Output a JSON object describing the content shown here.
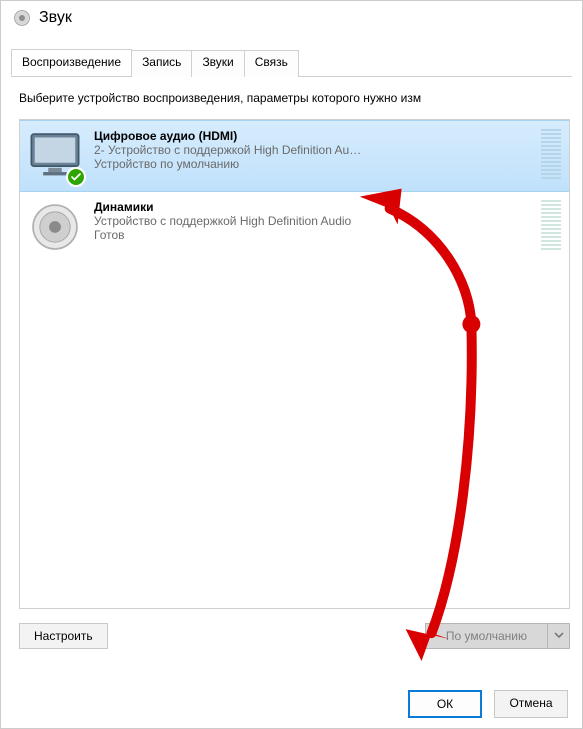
{
  "window": {
    "title": "Звук"
  },
  "tabs": {
    "items": [
      {
        "label": "Воспроизведение"
      },
      {
        "label": "Запись"
      },
      {
        "label": "Звуки"
      },
      {
        "label": "Связь"
      }
    ]
  },
  "instruction": "Выберите устройство воспроизведения, параметры которого нужно изм",
  "devices": [
    {
      "title": "Цифровое аудио (HDMI)",
      "subtitle": "2- Устройство с поддержкой High Definition Au…",
      "status": "Устройство по умолчанию",
      "selected": true,
      "default": true,
      "kind": "monitor"
    },
    {
      "title": "Динамики",
      "subtitle": "Устройство с поддержкой High Definition Audio",
      "status": "Готов",
      "selected": false,
      "default": false,
      "kind": "speaker"
    }
  ],
  "buttons": {
    "configure": "Настроить",
    "set_default": "По умолчанию",
    "ok": "ОК",
    "cancel": "Отмена"
  },
  "icons": {
    "sound": "sound-icon",
    "monitor": "monitor-icon",
    "speaker": "speaker-icon",
    "check": "check-icon",
    "dropdown": "chevron-down-icon"
  }
}
